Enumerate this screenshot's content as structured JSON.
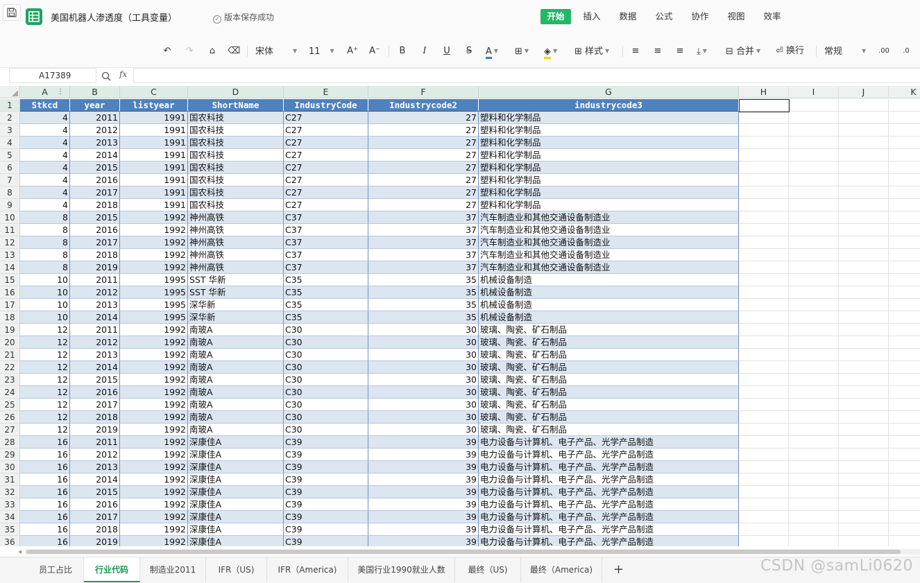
{
  "titlebar": {
    "doc_title": "美国机器人渗透度（工具变量）",
    "save_status": "版本保存成功",
    "menus": [
      "开始",
      "插入",
      "数据",
      "公式",
      "协作",
      "视图",
      "效率"
    ],
    "active_menu": "开始"
  },
  "toolbar": {
    "undo_icon": "undo-icon",
    "redo_icon": "redo-icon",
    "font_name": "宋体",
    "font_size": "11",
    "grow_font": "A⁺",
    "shrink_font": "A⁻",
    "bold": "B",
    "italic": "I",
    "underline": "U",
    "strike": "S",
    "font_color": "A",
    "style_label": "样式",
    "merge_label": "合并",
    "wrap_label": "换行",
    "number_format": "常规"
  },
  "formula_bar": {
    "name_box": "A17389",
    "fx": "fx",
    "formula": ""
  },
  "columns": [
    "A",
    "B",
    "C",
    "D",
    "E",
    "F",
    "G",
    "H",
    "I",
    "J",
    "K"
  ],
  "header_row": [
    "Stkcd",
    "year",
    "listyear",
    "ShortName",
    "IndustryCode",
    "Industrycode2",
    "industrycode3"
  ],
  "rows": [
    [
      4,
      2011,
      1991,
      "国农科技",
      "C27",
      27,
      "塑料和化学制品"
    ],
    [
      4,
      2012,
      1991,
      "国农科技",
      "C27",
      27,
      "塑料和化学制品"
    ],
    [
      4,
      2013,
      1991,
      "国农科技",
      "C27",
      27,
      "塑料和化学制品"
    ],
    [
      4,
      2014,
      1991,
      "国农科技",
      "C27",
      27,
      "塑料和化学制品"
    ],
    [
      4,
      2015,
      1991,
      "国农科技",
      "C27",
      27,
      "塑料和化学制品"
    ],
    [
      4,
      2016,
      1991,
      "国农科技",
      "C27",
      27,
      "塑料和化学制品"
    ],
    [
      4,
      2017,
      1991,
      "国农科技",
      "C27",
      27,
      "塑料和化学制品"
    ],
    [
      4,
      2018,
      1991,
      "国农科技",
      "C27",
      27,
      "塑料和化学制品"
    ],
    [
      8,
      2015,
      1992,
      "神州高铁",
      "C37",
      37,
      "汽车制造业和其他交通设备制造业"
    ],
    [
      8,
      2016,
      1992,
      "神州高铁",
      "C37",
      37,
      "汽车制造业和其他交通设备制造业"
    ],
    [
      8,
      2017,
      1992,
      "神州高铁",
      "C37",
      37,
      "汽车制造业和其他交通设备制造业"
    ],
    [
      8,
      2018,
      1992,
      "神州高铁",
      "C37",
      37,
      "汽车制造业和其他交通设备制造业"
    ],
    [
      8,
      2019,
      1992,
      "神州高铁",
      "C37",
      37,
      "汽车制造业和其他交通设备制造业"
    ],
    [
      10,
      2011,
      1995,
      "SST 华新",
      "C35",
      35,
      "机械设备制造"
    ],
    [
      10,
      2012,
      1995,
      "SST 华新",
      "C35",
      35,
      "机械设备制造"
    ],
    [
      10,
      2013,
      1995,
      "深华新",
      "C35",
      35,
      "机械设备制造"
    ],
    [
      10,
      2014,
      1995,
      "深华新",
      "C35",
      35,
      "机械设备制造"
    ],
    [
      12,
      2011,
      1992,
      "南玻A",
      "C30",
      30,
      "玻璃、陶瓷、矿石制品"
    ],
    [
      12,
      2012,
      1992,
      "南玻A",
      "C30",
      30,
      "玻璃、陶瓷、矿石制品"
    ],
    [
      12,
      2013,
      1992,
      "南玻A",
      "C30",
      30,
      "玻璃、陶瓷、矿石制品"
    ],
    [
      12,
      2014,
      1992,
      "南玻A",
      "C30",
      30,
      "玻璃、陶瓷、矿石制品"
    ],
    [
      12,
      2015,
      1992,
      "南玻A",
      "C30",
      30,
      "玻璃、陶瓷、矿石制品"
    ],
    [
      12,
      2016,
      1992,
      "南玻A",
      "C30",
      30,
      "玻璃、陶瓷、矿石制品"
    ],
    [
      12,
      2017,
      1992,
      "南玻A",
      "C30",
      30,
      "玻璃、陶瓷、矿石制品"
    ],
    [
      12,
      2018,
      1992,
      "南玻A",
      "C30",
      30,
      "玻璃、陶瓷、矿石制品"
    ],
    [
      12,
      2019,
      1992,
      "南玻A",
      "C30",
      30,
      "玻璃、陶瓷、矿石制品"
    ],
    [
      16,
      2011,
      1992,
      "深康佳A",
      "C39",
      39,
      "电力设备与计算机、电子产品、光学产品制造"
    ],
    [
      16,
      2012,
      1992,
      "深康佳A",
      "C39",
      39,
      "电力设备与计算机、电子产品、光学产品制造"
    ],
    [
      16,
      2013,
      1992,
      "深康佳A",
      "C39",
      39,
      "电力设备与计算机、电子产品、光学产品制造"
    ],
    [
      16,
      2014,
      1992,
      "深康佳A",
      "C39",
      39,
      "电力设备与计算机、电子产品、光学产品制造"
    ],
    [
      16,
      2015,
      1992,
      "深康佳A",
      "C39",
      39,
      "电力设备与计算机、电子产品、光学产品制造"
    ],
    [
      16,
      2016,
      1992,
      "深康佳A",
      "C39",
      39,
      "电力设备与计算机、电子产品、光学产品制造"
    ],
    [
      16,
      2017,
      1992,
      "深康佳A",
      "C39",
      39,
      "电力设备与计算机、电子产品、光学产品制造"
    ],
    [
      16,
      2018,
      1992,
      "深康佳A",
      "C39",
      39,
      "电力设备与计算机、电子产品、光学产品制造"
    ],
    [
      16,
      2019,
      1992,
      "深康佳A",
      "C39",
      39,
      "电力设备与计算机、电子产品、光学产品制造"
    ]
  ],
  "sheet_tabs": [
    "员工占比",
    "行业代码",
    "制造业2011",
    "IFR（US)",
    "IFR（America)",
    "美国行业1990就业人数",
    "最终（US)",
    "最终（America)"
  ],
  "active_sheet": "行业代码",
  "watermark": "CSDN @samLi0620",
  "colors": {
    "accent_green": "#21b866",
    "header_blue": "#4f81bd",
    "band_blue": "#dce6f1"
  }
}
